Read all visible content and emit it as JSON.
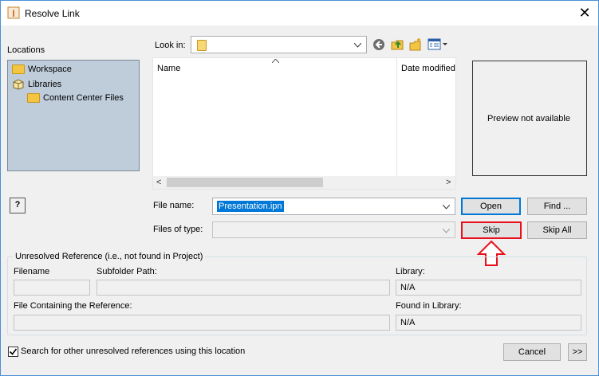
{
  "window": {
    "title": "Resolve Link",
    "close_label": "✕"
  },
  "locations": {
    "heading": "Locations",
    "items": [
      {
        "label": "Workspace"
      },
      {
        "label": "Libraries"
      },
      {
        "label": "Content Center Files"
      }
    ]
  },
  "help_label": "?",
  "look_in": {
    "label": "Look in:",
    "value": ""
  },
  "file_list": {
    "columns": [
      "Name",
      "Date modified"
    ],
    "scroll_left": "<",
    "scroll_right": ">"
  },
  "preview_text": "Preview not available",
  "file_name": {
    "label": "File name:",
    "value": "Presentation.ipn"
  },
  "files_of_type": {
    "label": "Files of type:",
    "value": ""
  },
  "buttons": {
    "open": "Open",
    "find": "Find ...",
    "skip": "Skip",
    "skip_all": "Skip All",
    "cancel": "Cancel",
    "expand": ">>"
  },
  "unresolved": {
    "heading": "Unresolved Reference (i.e., not found in Project)",
    "filename_label": "Filename",
    "subfolder_label": "Subfolder Path:",
    "library_label": "Library:",
    "library_value": "N/A",
    "containing_label": "File Containing the Reference:",
    "found_in_library_label": "Found in Library:",
    "found_in_library_value": "N/A"
  },
  "search_checkbox": {
    "label": "Search for other unresolved references using this location",
    "checked": true
  },
  "colors": {
    "highlight_red": "#e8101a",
    "selection_blue": "#0078d7",
    "locations_bg": "#bfcddb"
  }
}
